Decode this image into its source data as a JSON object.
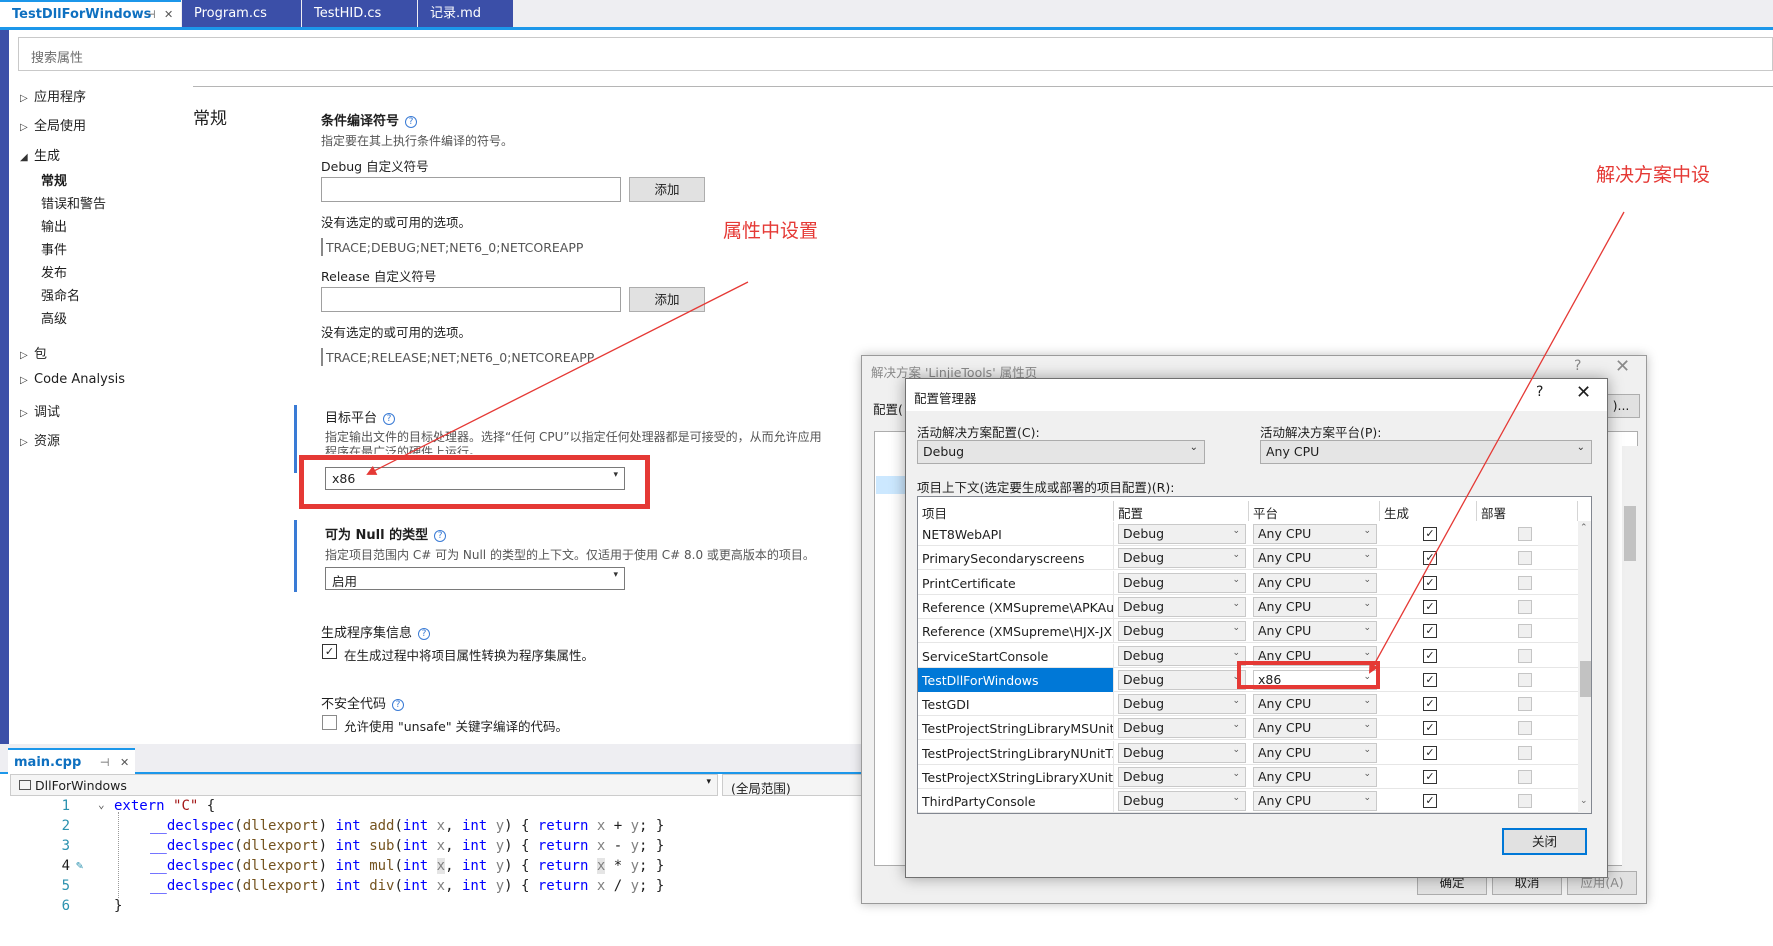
{
  "doc_tabs": [
    {
      "label": "TestDllForWindows",
      "active": true
    },
    {
      "label": "Program.cs",
      "active": false
    },
    {
      "label": "TestHID.cs",
      "active": false
    },
    {
      "label": "记录.md",
      "active": false
    }
  ],
  "search": {
    "placeholder": "搜索属性"
  },
  "nav": {
    "items": [
      "应用程序",
      "全局使用",
      "生成",
      "包",
      "Code Analysis",
      "调试",
      "资源"
    ],
    "sub_items": [
      "常规",
      "错误和警告",
      "输出",
      "事件",
      "发布",
      "强命名",
      "高级"
    ]
  },
  "section": {
    "title": "常规"
  },
  "cond": {
    "label": "条件编译符号",
    "desc": "指定要在其上执行条件编译的符号。",
    "debug_label": "Debug 自定义符号",
    "add_btn": "添加",
    "none_text": "没有选定的或可用的选项。",
    "debug_symbols": "TRACE;DEBUG;NET;NET6_0;NETCOREAPP",
    "release_label": "Release 自定义符号",
    "release_symbols": "TRACE;RELEASE;NET;NET6_0;NETCOREAPP"
  },
  "target": {
    "label": "目标平台",
    "desc1": "指定输出文件的目标处理器。选择“任何 CPU”以指定任何处理器都是可接受的，从而允许应用",
    "desc2": "程序在最广泛的硬件上运行。",
    "value": "x86"
  },
  "nullable": {
    "label": "可为 Null 的类型",
    "desc": "指定项目范围内 C# 可为 Null 的类型的上下文。仅适用于使用 C# 8.0 或更高版本的项目。",
    "value": "启用"
  },
  "asm": {
    "label": "生成程序集信息",
    "checkbox": "在生成过程中将项目属性转换为程序集属性。"
  },
  "unsafe": {
    "label": "不安全代码",
    "checkbox": "允许使用 \"unsafe\" 关键字编译的代码。"
  },
  "annotations": {
    "left": "属性中设置",
    "right": "解决方案中设"
  },
  "editor": {
    "tab": "main.cpp",
    "nav_left": "DllForWindows",
    "nav_right": "(全局范围)",
    "line_numbers": [
      "1",
      "2",
      "3",
      "4",
      "5",
      "6"
    ]
  },
  "back_dialog": {
    "title": "解决方案 'LinjieTools' 属性页",
    "help": "?",
    "config_prefix": "配置(",
    "btn_frag": ")...",
    "ok": "确定",
    "cancel": "取消",
    "apply": "应用(A)"
  },
  "front_dialog": {
    "title": "配置管理器",
    "help": "?",
    "active_config_label": "活动解决方案配置(C):",
    "active_config": "Debug",
    "active_platform_label": "活动解决方案平台(P):",
    "active_platform": "Any CPU",
    "contexts_label": "项目上下文(选定要生成或部署的项目配置)(R):",
    "headers": [
      "项目",
      "配置",
      "平台",
      "生成",
      "部署"
    ],
    "rows": [
      {
        "project": "NET8WebAPI",
        "config": "Debug",
        "platform": "Any CPU",
        "build": true
      },
      {
        "project": "PrimarySecondaryscreens",
        "config": "Debug",
        "platform": "Any CPU",
        "build": true
      },
      {
        "project": "PrintCertificate",
        "config": "Debug",
        "platform": "Any CPU",
        "build": true
      },
      {
        "project": "Reference (XMSupreme\\APKAu...",
        "config": "Debug",
        "platform": "Any CPU",
        "build": true
      },
      {
        "project": "Reference (XMSupreme\\HJX-JX...",
        "config": "Debug",
        "platform": "Any CPU",
        "build": true
      },
      {
        "project": "ServiceStartConsole",
        "config": "Debug",
        "platform": "Any CPU",
        "build": true
      },
      {
        "project": "TestDllForWindows",
        "config": "Debug",
        "platform": "x86",
        "build": true,
        "selected": true
      },
      {
        "project": "TestGDI",
        "config": "Debug",
        "platform": "Any CPU",
        "build": true
      },
      {
        "project": "TestProjectStringLibraryMSUnit...",
        "config": "Debug",
        "platform": "Any CPU",
        "build": true
      },
      {
        "project": "TestProjectStringLibraryNUnitT...",
        "config": "Debug",
        "platform": "Any CPU",
        "build": true
      },
      {
        "project": "TestProjectXStringLibraryXUnit...",
        "config": "Debug",
        "platform": "Any CPU",
        "build": true
      },
      {
        "project": "ThirdPartyConsole",
        "config": "Debug",
        "platform": "Any CPU",
        "build": true
      }
    ],
    "close": "关闭"
  },
  "colors": {
    "accent": "#1c97ea",
    "annotation": "#e53935",
    "selection": "#0078d7"
  }
}
